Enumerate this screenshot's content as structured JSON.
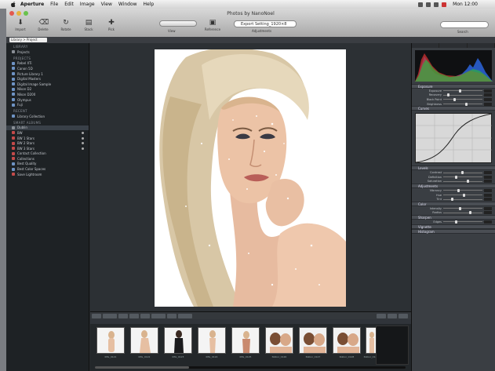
{
  "menubar": {
    "app_name": "Aperture",
    "items": [
      "File",
      "Edit",
      "Image",
      "View",
      "Window",
      "Help"
    ],
    "clock": "Mon 12:00"
  },
  "window": {
    "title": "Photos by NanoNoel",
    "tools": [
      "Import",
      "Delete",
      "Rotate",
      "Stack",
      "Pick"
    ],
    "tools_right": [
      "Reference",
      "Update",
      "Zoom",
      "Viewer"
    ],
    "seg_label": "View",
    "album_field": "Export Setting_1920×8",
    "album_label": "Adjustments",
    "search_label": "Search",
    "path": "Library > Project"
  },
  "sidebar": {
    "section_library": "Library",
    "library_items": [
      "Projects",
      "Last Week",
      "Last 2 Weeks",
      "Last 4 Weeks"
    ],
    "section_projects": "Projects",
    "project_items": [
      "Rebel XTi",
      "Canon 5D",
      "Picture Library 1",
      "Digital Masters",
      "Digital Image Sample",
      "Nikon D2",
      "Nikon D200",
      "Olympus",
      "Fuji"
    ],
    "section_recent": "Recent",
    "recent_items": [
      "Library Collection"
    ],
    "section_smart": "Smart Albums",
    "smart_items": [
      "Dublin",
      "BW",
      "BW 1 Stars",
      "BW 2 Stars",
      "BW 3 Stars",
      "Contact Collection",
      "Collections",
      "Best Quality",
      "Best Color Spaces",
      "Save Lightroom"
    ]
  },
  "browser": {
    "thumbs": [
      {
        "name": "IMG_0121",
        "kind": "full"
      },
      {
        "name": "IMG_0122",
        "kind": "full"
      },
      {
        "name": "IMG_0123",
        "kind": "dark"
      },
      {
        "name": "IMG_0124",
        "kind": "full"
      },
      {
        "name": "IMG_0125",
        "kind": "full"
      },
      {
        "name": "Nikkor_0126",
        "kind": "pair"
      },
      {
        "name": "Nikkor_0127",
        "kind": "pair"
      },
      {
        "name": "Nikkor_0128",
        "kind": "pair"
      },
      {
        "name": "Nikkor_0129",
        "kind": "full"
      }
    ]
  },
  "inspector": {
    "sections": [
      "Histogram",
      "Exposure",
      "Levels",
      "Curves",
      "Adjustments",
      "Color",
      "Sharpen",
      "Vignette"
    ],
    "exposure_rows": [
      "Exposure",
      "Recovery",
      "Black Point",
      "Brightness"
    ],
    "adjust_rows": [
      "Contrast",
      "Definition",
      "Saturation",
      "Vibrancy",
      "Hue",
      "Tint"
    ],
    "sharpen_rows": [
      "Intensity",
      "Radius",
      "Edges"
    ]
  }
}
